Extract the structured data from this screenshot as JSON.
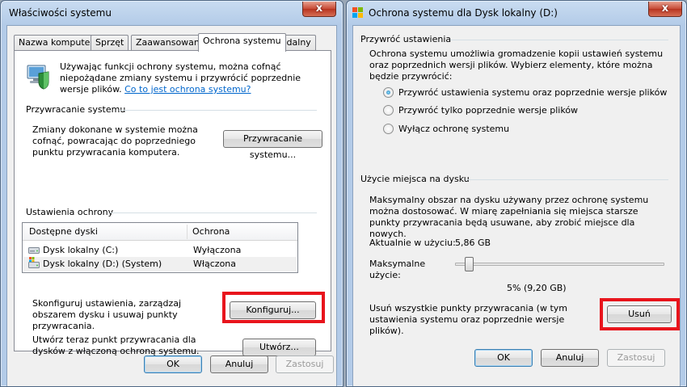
{
  "left_window": {
    "title": "Właściwości systemu",
    "close_label": "x",
    "tabs": [
      {
        "label": "Nazwa komputera"
      },
      {
        "label": "Sprzęt"
      },
      {
        "label": "Zaawansowane"
      },
      {
        "label": "Ochrona systemu"
      },
      {
        "label": "Zdalny"
      }
    ],
    "intro": {
      "text": "Używając funkcji ochrony systemu, można cofnąć niepożądane zmiany systemu i przywrócić poprzednie wersje plików.",
      "link": "Co to jest ochrona systemu?"
    },
    "restore_section": {
      "heading": "Przywracanie systemu",
      "text": "Zmiany dokonane w systemie można cofnąć, powracając do poprzedniego punktu przywracania komputera.",
      "button": "Przywracanie systemu..."
    },
    "protection_section": {
      "heading": "Ustawienia ochrony",
      "columns": [
        "Dostępne dyski",
        "Ochrona"
      ],
      "rows": [
        {
          "drive": "Dysk lokalny (C:)",
          "status": "Wyłączona"
        },
        {
          "drive": "Dysk lokalny (D:) (System)",
          "status": "Włączona"
        }
      ],
      "configure_text": "Skonfiguruj ustawienia, zarządzaj obszarem dysku i usuwaj punkty przywracania.",
      "configure_button": "Konfiguruj...",
      "create_text": "Utwórz teraz punkt przywracania dla dysków z włączoną ochroną systemu.",
      "create_button": "Utwórz..."
    },
    "buttons": {
      "ok": "OK",
      "cancel": "Anuluj",
      "apply": "Zastosuj"
    }
  },
  "right_window": {
    "title": "Ochrona systemu dla Dysk lokalny (D:)",
    "close_label": "x",
    "restore_settings": {
      "heading": "Przywróć ustawienia",
      "description": "Ochrona systemu umożliwia gromadzenie kopii ustawień systemu oraz poprzednich wersji plików. Wybierz elementy, które można będzie przywrócić:",
      "options": [
        {
          "label": "Przywróć ustawienia systemu oraz poprzednie wersje plików",
          "checked": true
        },
        {
          "label": "Przywróć tylko poprzednie wersje plików",
          "checked": false
        },
        {
          "label": "Wyłącz ochronę systemu",
          "checked": false
        }
      ]
    },
    "disk_usage": {
      "heading": "Użycie miejsca na dysku",
      "description": "Maksymalny obszar na dysku używany przez ochronę systemu można dostosować. W miarę zapełniania się miejsca starsze punkty przywracania będą usuwane, aby zrobić miejsce dla nowych.",
      "current_label": "Aktualnie w użyciu:",
      "current_value": "5,86 GB",
      "max_label": "Maksymalne użycie:",
      "slider_fraction": 0.05,
      "slider_value": "5% (9,20 GB)",
      "delete_text": "Usuń wszystkie punkty przywracania (w tym ustawienia systemu oraz poprzednie wersje plików).",
      "delete_button": "Usuń"
    },
    "buttons": {
      "ok": "OK",
      "cancel": "Anuluj",
      "apply": "Zastosuj"
    }
  },
  "colors": {
    "highlight_box": "#e8141c",
    "link": "#0066cc"
  }
}
